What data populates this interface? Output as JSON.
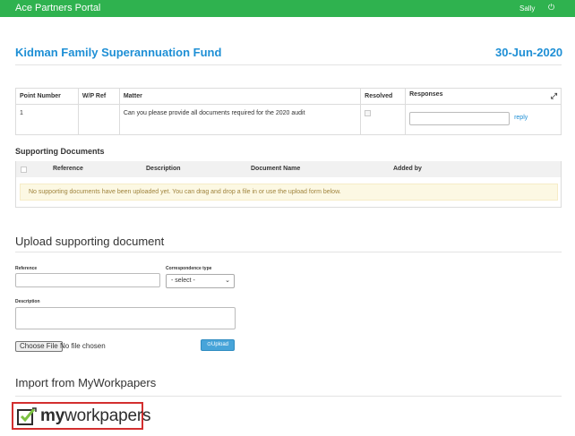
{
  "header": {
    "brand": "Ace Partners Portal",
    "user": "Sally",
    "power_icon": "power-icon",
    "background_color": "#2fb24f"
  },
  "fund": {
    "title": "Kidman Family Superannuation Fund",
    "date": "30-Jun-2020",
    "accent_color": "#1e8fd5"
  },
  "points_table": {
    "headers": {
      "point_number": "Point Number",
      "wp_ref": "W/P Ref",
      "matter": "Matter",
      "resolved": "Resolved",
      "responses": "Responses"
    },
    "expand_icon": "expand-icon",
    "rows": [
      {
        "point_number": "1",
        "wp_ref": "",
        "matter": "Can you please provide all documents required for the 2020 audit",
        "resolved": false,
        "response_value": "",
        "reply_label": "reply"
      }
    ]
  },
  "supporting_documents": {
    "title": "Supporting Documents",
    "headers": {
      "reference": "Reference",
      "description": "Description",
      "document_name": "Document Name",
      "added_by": "Added by"
    },
    "empty_message": "No supporting documents have been uploaded yet. You can drag and drop a file in or use the upload form below."
  },
  "upload_form": {
    "title": "Upload supporting document",
    "reference_label": "Reference",
    "reference_value": "",
    "correspondence_label": "Correspondence type",
    "correspondence_selected": "- select -",
    "description_label": "Description",
    "description_value": "",
    "choose_file_label": "Choose File",
    "file_status": "No file chosen",
    "upload_button": "Upload",
    "upload_icon": "upload-circle-icon"
  },
  "import": {
    "title": "Import from MyWorkpapers",
    "logo_icon": "myworkpapers-checkbox-logo-icon",
    "logo_text_my": "my",
    "logo_text_rest": "workpapers"
  }
}
